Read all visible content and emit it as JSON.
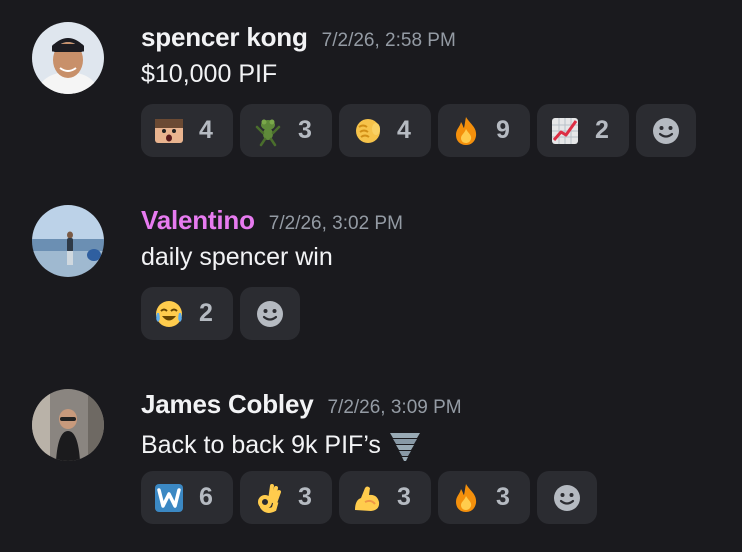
{
  "messages": [
    {
      "username": "spencer kong",
      "timestamp": "7/2/26, 2:58 PM",
      "text": "$10,000 PIF",
      "reactions": [
        {
          "icon": "shocked-face-custom-icon",
          "count": "4"
        },
        {
          "icon": "dancing-frog-icon",
          "count": "3"
        },
        {
          "icon": "fist-bump-icon",
          "count": "4"
        },
        {
          "icon": "fire-icon",
          "count": "9"
        },
        {
          "icon": "chart-increasing-icon",
          "count": "2"
        }
      ]
    },
    {
      "username": "Valentino",
      "username_color": "#e77bf0",
      "timestamp": "7/2/26, 3:02 PM",
      "text": "daily spencer win",
      "reactions": [
        {
          "icon": "tears-of-joy-icon",
          "count": "2"
        }
      ]
    },
    {
      "username": "James Cobley",
      "timestamp": "7/2/26, 3:09 PM",
      "text": "Back to back 9k PIF’s",
      "inline_icon": "tornado-icon",
      "reactions": [
        {
          "icon": "letter-w-icon",
          "count": "6"
        },
        {
          "icon": "ok-hand-icon",
          "count": "3"
        },
        {
          "icon": "flexed-biceps-icon",
          "count": "3"
        },
        {
          "icon": "fire-icon",
          "count": "3"
        }
      ]
    }
  ],
  "add_reaction_icon": "add-reaction-smiley-icon"
}
